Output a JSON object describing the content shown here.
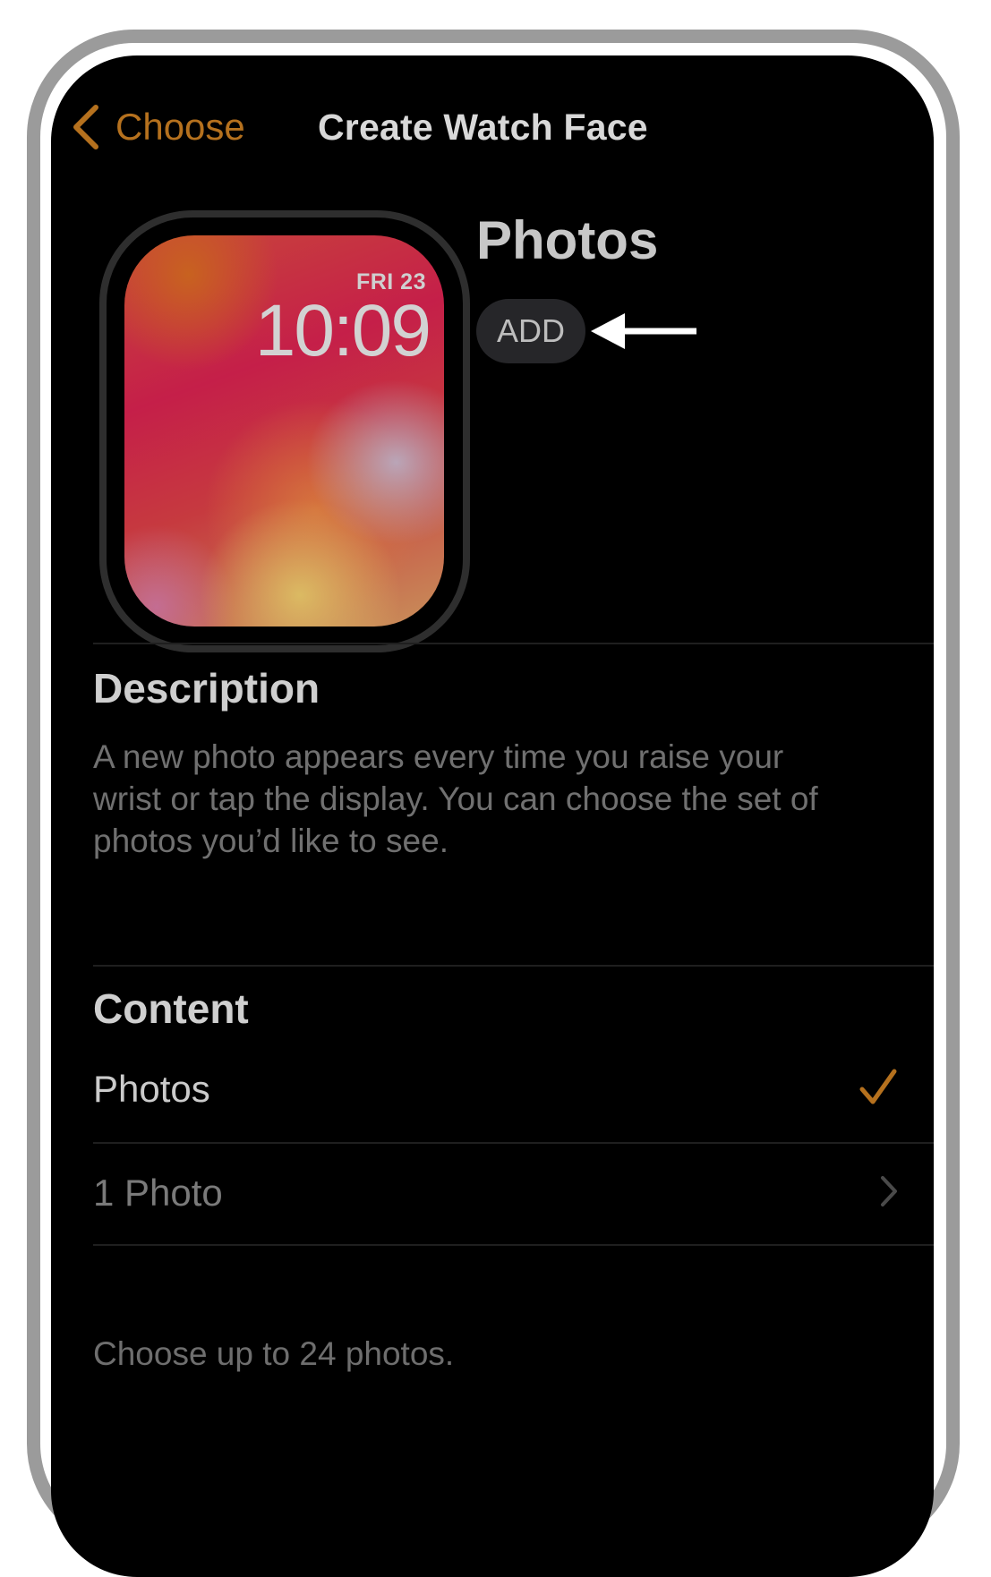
{
  "nav": {
    "back_label": "Choose",
    "title": "Create Watch Face"
  },
  "watch_preview": {
    "date": "FRI 23",
    "time": "10:09"
  },
  "face": {
    "name": "Photos",
    "add_label": "ADD"
  },
  "description": {
    "heading": "Description",
    "body": "A new photo appears every time you raise your wrist or tap the display. You can choose the set of photos you’d like to see."
  },
  "content": {
    "heading": "Content",
    "option_label": "Photos",
    "option_selected": true,
    "photo_count_label": "1 Photo",
    "footnote": "Choose up to 24 photos."
  },
  "colors": {
    "accent": "#b5711e",
    "background": "#000000"
  },
  "icons": {
    "back": "chevron-left-icon",
    "selected": "checkmark-icon",
    "disclosure": "chevron-right-icon",
    "annotation": "arrow-left-icon"
  }
}
